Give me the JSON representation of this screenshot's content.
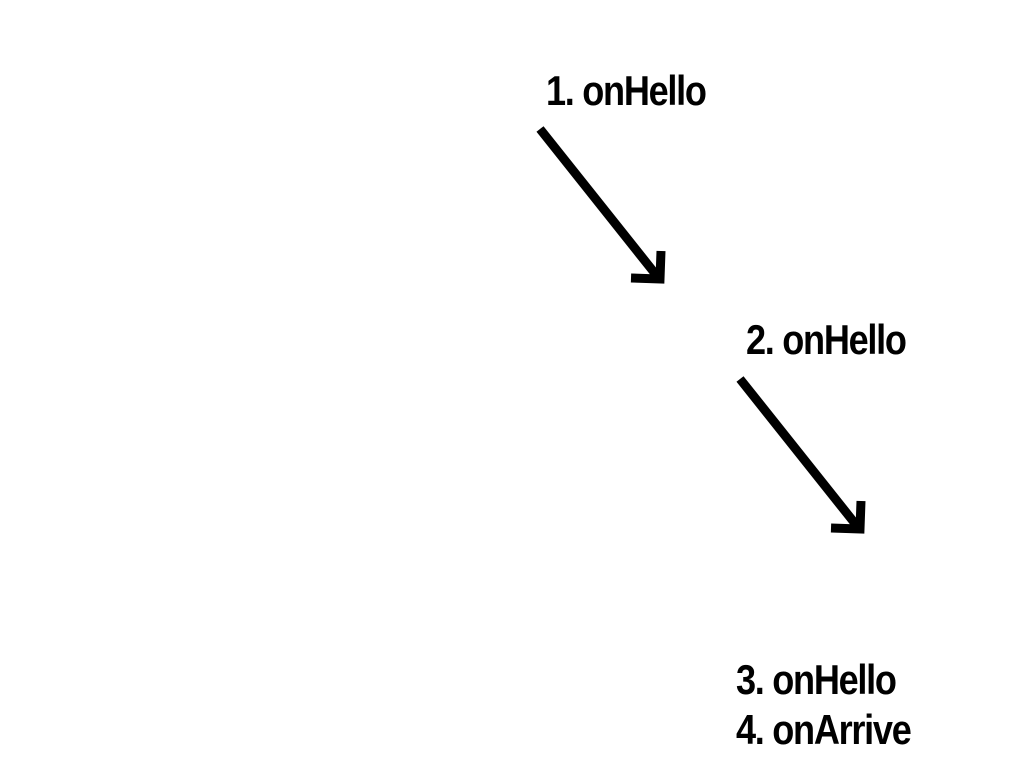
{
  "steps": [
    {
      "label": "1. onHello"
    },
    {
      "label": "2. onHello"
    },
    {
      "label": "3. onHello"
    },
    {
      "label": "4. onArrive"
    }
  ],
  "colors": {
    "text": "#000000",
    "arrow": "#000000",
    "background": "#ffffff"
  },
  "icons": [
    "arrow-down-right-icon",
    "arrow-down-right-icon"
  ]
}
